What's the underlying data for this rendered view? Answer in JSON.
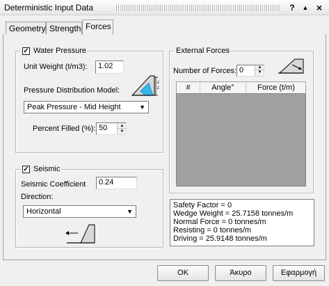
{
  "window": {
    "title": "Deterministic Input Data",
    "help_label": "?",
    "collapse_label": "▲",
    "close_label": "×"
  },
  "tabs": [
    {
      "label": "Geometry",
      "active": false
    },
    {
      "label": "Strength",
      "active": false
    },
    {
      "label": "Forces",
      "active": true
    }
  ],
  "water_pressure": {
    "label": "Water Pressure",
    "checked": true,
    "unit_weight_label": "Unit Weight (t/m3):",
    "unit_weight_value": "1.02",
    "distribution_label": "Pressure Distribution Model:",
    "distribution_value": "Peak Pressure - Mid Height",
    "percent_label": "Percent Filled (%):",
    "percent_value": "50",
    "icon": "water-pressure-wedge-icon"
  },
  "seismic": {
    "label": "Seismic",
    "checked": true,
    "coefficient_label": "Seismic Coefficient",
    "coefficient_value": "0.24",
    "direction_label": "Direction:",
    "direction_value": "Horizontal",
    "icon": "seismic-slope-icon"
  },
  "external_forces": {
    "label": "External Forces",
    "count_label": "Number of Forces:",
    "count_value": "0",
    "columns": [
      "#",
      "Angle°",
      "Force (t/m)"
    ],
    "icon": "external-force-slope-icon"
  },
  "results": [
    "Safety Factor = 0",
    "Wedge Weight = 25.7158 tonnes/m",
    "Normal Force = 0 tonnes/m",
    "Resisting = 0 tonnes/m",
    "Driving = 25.9148 tonnes/m"
  ],
  "buttons": {
    "ok": "OK",
    "cancel": "Άκυρο",
    "apply": "Εφαρμογή"
  },
  "colors": {
    "grid_body": "#a0a0a0",
    "water_fill": "#2fb8e8"
  }
}
